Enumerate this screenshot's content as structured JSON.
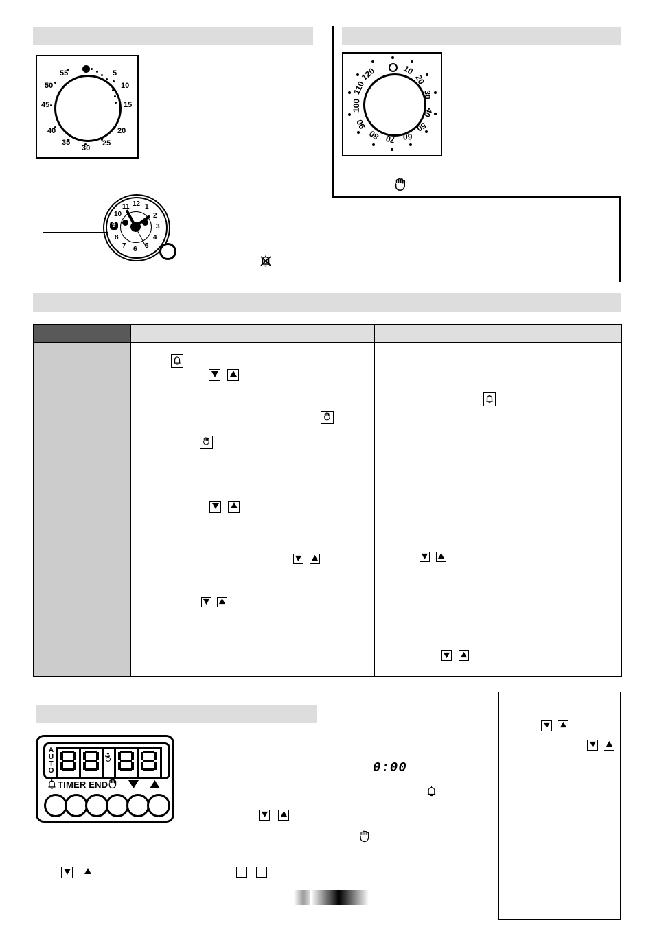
{
  "page": {
    "domain_note": "scanned appliance manual page – oven timer controls",
    "background": "#ffffff",
    "accent_header": "#dddddd",
    "table_header_dark": "#595959",
    "table_header_grey": "#dfdfdf",
    "table_rowlabel_grey": "#cccccc"
  },
  "sections": {
    "minute_minder_heading": "",
    "timer_heading": "",
    "table_heading": "",
    "digital_heading": ""
  },
  "minute_dial": {
    "name": "minute-minder-dial",
    "unit": "minutes",
    "max": 60,
    "labels": [
      "5",
      "10",
      "15",
      "20",
      "25",
      "30",
      "35",
      "40",
      "45",
      "50",
      "55"
    ],
    "pointer_position": "0",
    "pointer_marker": "filled-dot"
  },
  "timer_dial": {
    "name": "timer-dial-120",
    "unit": "minutes",
    "max": 120,
    "zero_label": "0",
    "labels": [
      "10",
      "20",
      "30",
      "40",
      "50",
      "60",
      "70",
      "80",
      "90",
      "100",
      "110",
      "120"
    ],
    "caption_icon": "hand-icon"
  },
  "clock": {
    "name": "analog-clock",
    "numerals": [
      "12",
      "1",
      "2",
      "3",
      "4",
      "5",
      "6",
      "7",
      "8",
      "9",
      "10",
      "11"
    ],
    "highlighted_numeral": "9",
    "hour_hand_at": "10",
    "minute_hand_at": "2",
    "second_hand_at": "5",
    "side_icon": "bell-crossed-icon"
  },
  "table": {
    "name": "function-table",
    "columns": [
      {
        "label": "",
        "style": "dark"
      },
      {
        "label": "",
        "style": "grey"
      },
      {
        "label": "",
        "style": "grey"
      },
      {
        "label": "",
        "style": "grey"
      },
      {
        "label": "",
        "style": "grey"
      }
    ],
    "rows": [
      {
        "label": "",
        "cells": [
          {
            "icons": [
              "bell-icon",
              "down-arrow-icon",
              "up-arrow-icon"
            ]
          },
          {
            "icons": [
              "hand-icon"
            ]
          },
          {
            "icons": [
              "bell-icon"
            ]
          },
          {
            "icons": []
          }
        ]
      },
      {
        "label": "",
        "cells": [
          {
            "icons": [
              "hand-icon"
            ]
          },
          {
            "icons": []
          },
          {
            "icons": []
          },
          {
            "icons": []
          }
        ]
      },
      {
        "label": "",
        "cells": [
          {
            "icons": [
              "down-arrow-icon",
              "up-arrow-icon"
            ]
          },
          {
            "icons": [
              "down-arrow-icon",
              "up-arrow-icon"
            ]
          },
          {
            "icons": [
              "down-arrow-icon",
              "up-arrow-icon"
            ]
          },
          {
            "icons": []
          }
        ]
      },
      {
        "label": "",
        "cells": [
          {
            "icons": [
              "down-arrow-icon",
              "up-arrow-icon"
            ]
          },
          {
            "icons": []
          },
          {
            "icons": [
              "down-arrow-icon",
              "up-arrow-icon"
            ]
          },
          {
            "icons": []
          }
        ]
      }
    ]
  },
  "digital_panel": {
    "name": "digital-timer-panel",
    "auto_label": "AUTO",
    "display_value": "88:88",
    "digits": [
      "8",
      "8",
      "8",
      "8"
    ],
    "separator_icons": [
      "pot-icon",
      "dot-indicator"
    ],
    "button_labels": {
      "bell": "bell-icon",
      "timer_end": "TIMER END",
      "hand": "hand-icon",
      "down": "down-arrow-icon",
      "up": "up-arrow-icon"
    },
    "buttons": [
      {
        "name": "bell-button"
      },
      {
        "name": "timer-button"
      },
      {
        "name": "end-button"
      },
      {
        "name": "hand-button"
      },
      {
        "name": "down-button"
      },
      {
        "name": "up-button"
      }
    ]
  },
  "inline_marks": {
    "clock_value": "0:00",
    "bell_outline": "bell-icon",
    "hand_outline": "hand-icon",
    "arrows_left": [
      "down-arrow-icon",
      "up-arrow-icon"
    ],
    "empty_boxes": [
      "checkbox-empty",
      "checkbox-empty"
    ],
    "arrows_right_mid": [
      "down-arrow-icon",
      "up-arrow-icon"
    ],
    "arrows_right_low": [
      "down-arrow-icon",
      "up-arrow-icon"
    ]
  }
}
